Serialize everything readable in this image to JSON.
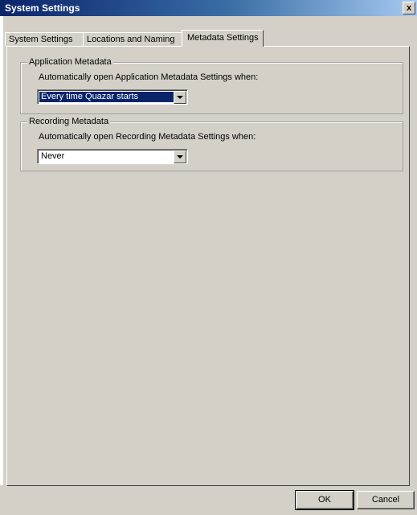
{
  "window": {
    "title": "System Settings",
    "close_label": "x"
  },
  "tabs": [
    {
      "label": "System Settings",
      "active": false
    },
    {
      "label": "Locations and Naming",
      "active": false
    },
    {
      "label": "Metadata Settings",
      "active": true
    }
  ],
  "groups": {
    "application": {
      "legend": "Application Metadata",
      "label": "Automatically open Application Metadata Settings when:",
      "selected": "Every time Quazar starts"
    },
    "recording": {
      "legend": "Recording Metadata",
      "label": "Automatically open Recording Metadata Settings when:",
      "selected": "Never"
    }
  },
  "buttons": {
    "ok": "OK",
    "cancel": "Cancel"
  },
  "colors": {
    "titlebar": "#0a246a",
    "face": "#d4d0c8",
    "selection": "#0a246a"
  }
}
